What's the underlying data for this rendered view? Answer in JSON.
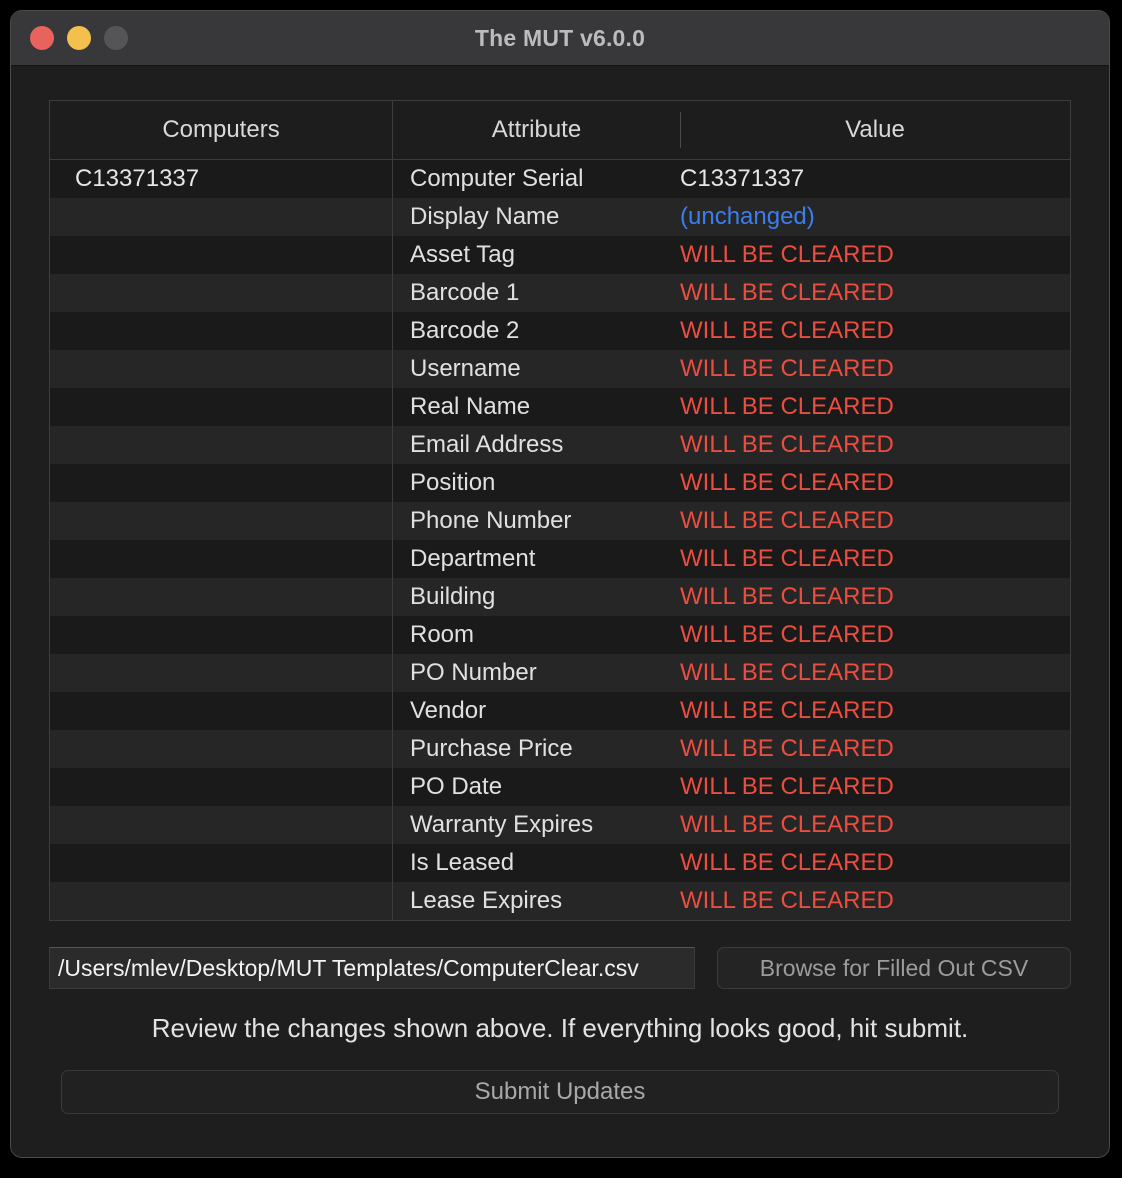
{
  "window": {
    "title": "The MUT v6.0.0",
    "traffic_lights": [
      {
        "name": "close-button",
        "color": "#e8635c"
      },
      {
        "name": "minimize-button",
        "color": "#f3bf4d"
      },
      {
        "name": "zoom-button",
        "color": "#555558"
      }
    ]
  },
  "colors": {
    "cleared": "#eb4d40",
    "unchanged": "#3b7ef0",
    "text": "#e6e6e6",
    "window_bg": "#1e1e1e",
    "titlebar_bg": "#38383a"
  },
  "table": {
    "headers": {
      "computers": "Computers",
      "attribute": "Attribute",
      "value": "Value"
    },
    "computer_serial": "C13371337",
    "rows": [
      {
        "attribute": "Computer Serial",
        "value": "C13371337",
        "state": "normal"
      },
      {
        "attribute": "Display Name",
        "value": "(unchanged)",
        "state": "unchanged"
      },
      {
        "attribute": "Asset Tag",
        "value": "WILL BE CLEARED",
        "state": "cleared"
      },
      {
        "attribute": "Barcode 1",
        "value": "WILL BE CLEARED",
        "state": "cleared"
      },
      {
        "attribute": "Barcode 2",
        "value": "WILL BE CLEARED",
        "state": "cleared"
      },
      {
        "attribute": "Username",
        "value": "WILL BE CLEARED",
        "state": "cleared"
      },
      {
        "attribute": "Real Name",
        "value": "WILL BE CLEARED",
        "state": "cleared"
      },
      {
        "attribute": "Email Address",
        "value": "WILL BE CLEARED",
        "state": "cleared"
      },
      {
        "attribute": "Position",
        "value": "WILL BE CLEARED",
        "state": "cleared"
      },
      {
        "attribute": "Phone Number",
        "value": "WILL BE CLEARED",
        "state": "cleared"
      },
      {
        "attribute": "Department",
        "value": "WILL BE CLEARED",
        "state": "cleared"
      },
      {
        "attribute": "Building",
        "value": "WILL BE CLEARED",
        "state": "cleared"
      },
      {
        "attribute": "Room",
        "value": "WILL BE CLEARED",
        "state": "cleared"
      },
      {
        "attribute": "PO Number",
        "value": "WILL BE CLEARED",
        "state": "cleared"
      },
      {
        "attribute": "Vendor",
        "value": "WILL BE CLEARED",
        "state": "cleared"
      },
      {
        "attribute": "Purchase Price",
        "value": "WILL BE CLEARED",
        "state": "cleared"
      },
      {
        "attribute": "PO Date",
        "value": "WILL BE CLEARED",
        "state": "cleared"
      },
      {
        "attribute": "Warranty Expires",
        "value": "WILL BE CLEARED",
        "state": "cleared"
      },
      {
        "attribute": "Is Leased",
        "value": "WILL BE CLEARED",
        "state": "cleared"
      },
      {
        "attribute": "Lease Expires",
        "value": "WILL BE CLEARED",
        "state": "cleared"
      }
    ]
  },
  "file_row": {
    "path_value": "/Users/mlev/Desktop/MUT Templates/ComputerClear.csv",
    "browse_label": "Browse for Filled Out CSV"
  },
  "instruction": "Review the changes shown above. If everything looks good, hit submit.",
  "submit": {
    "label": "Submit Updates"
  }
}
